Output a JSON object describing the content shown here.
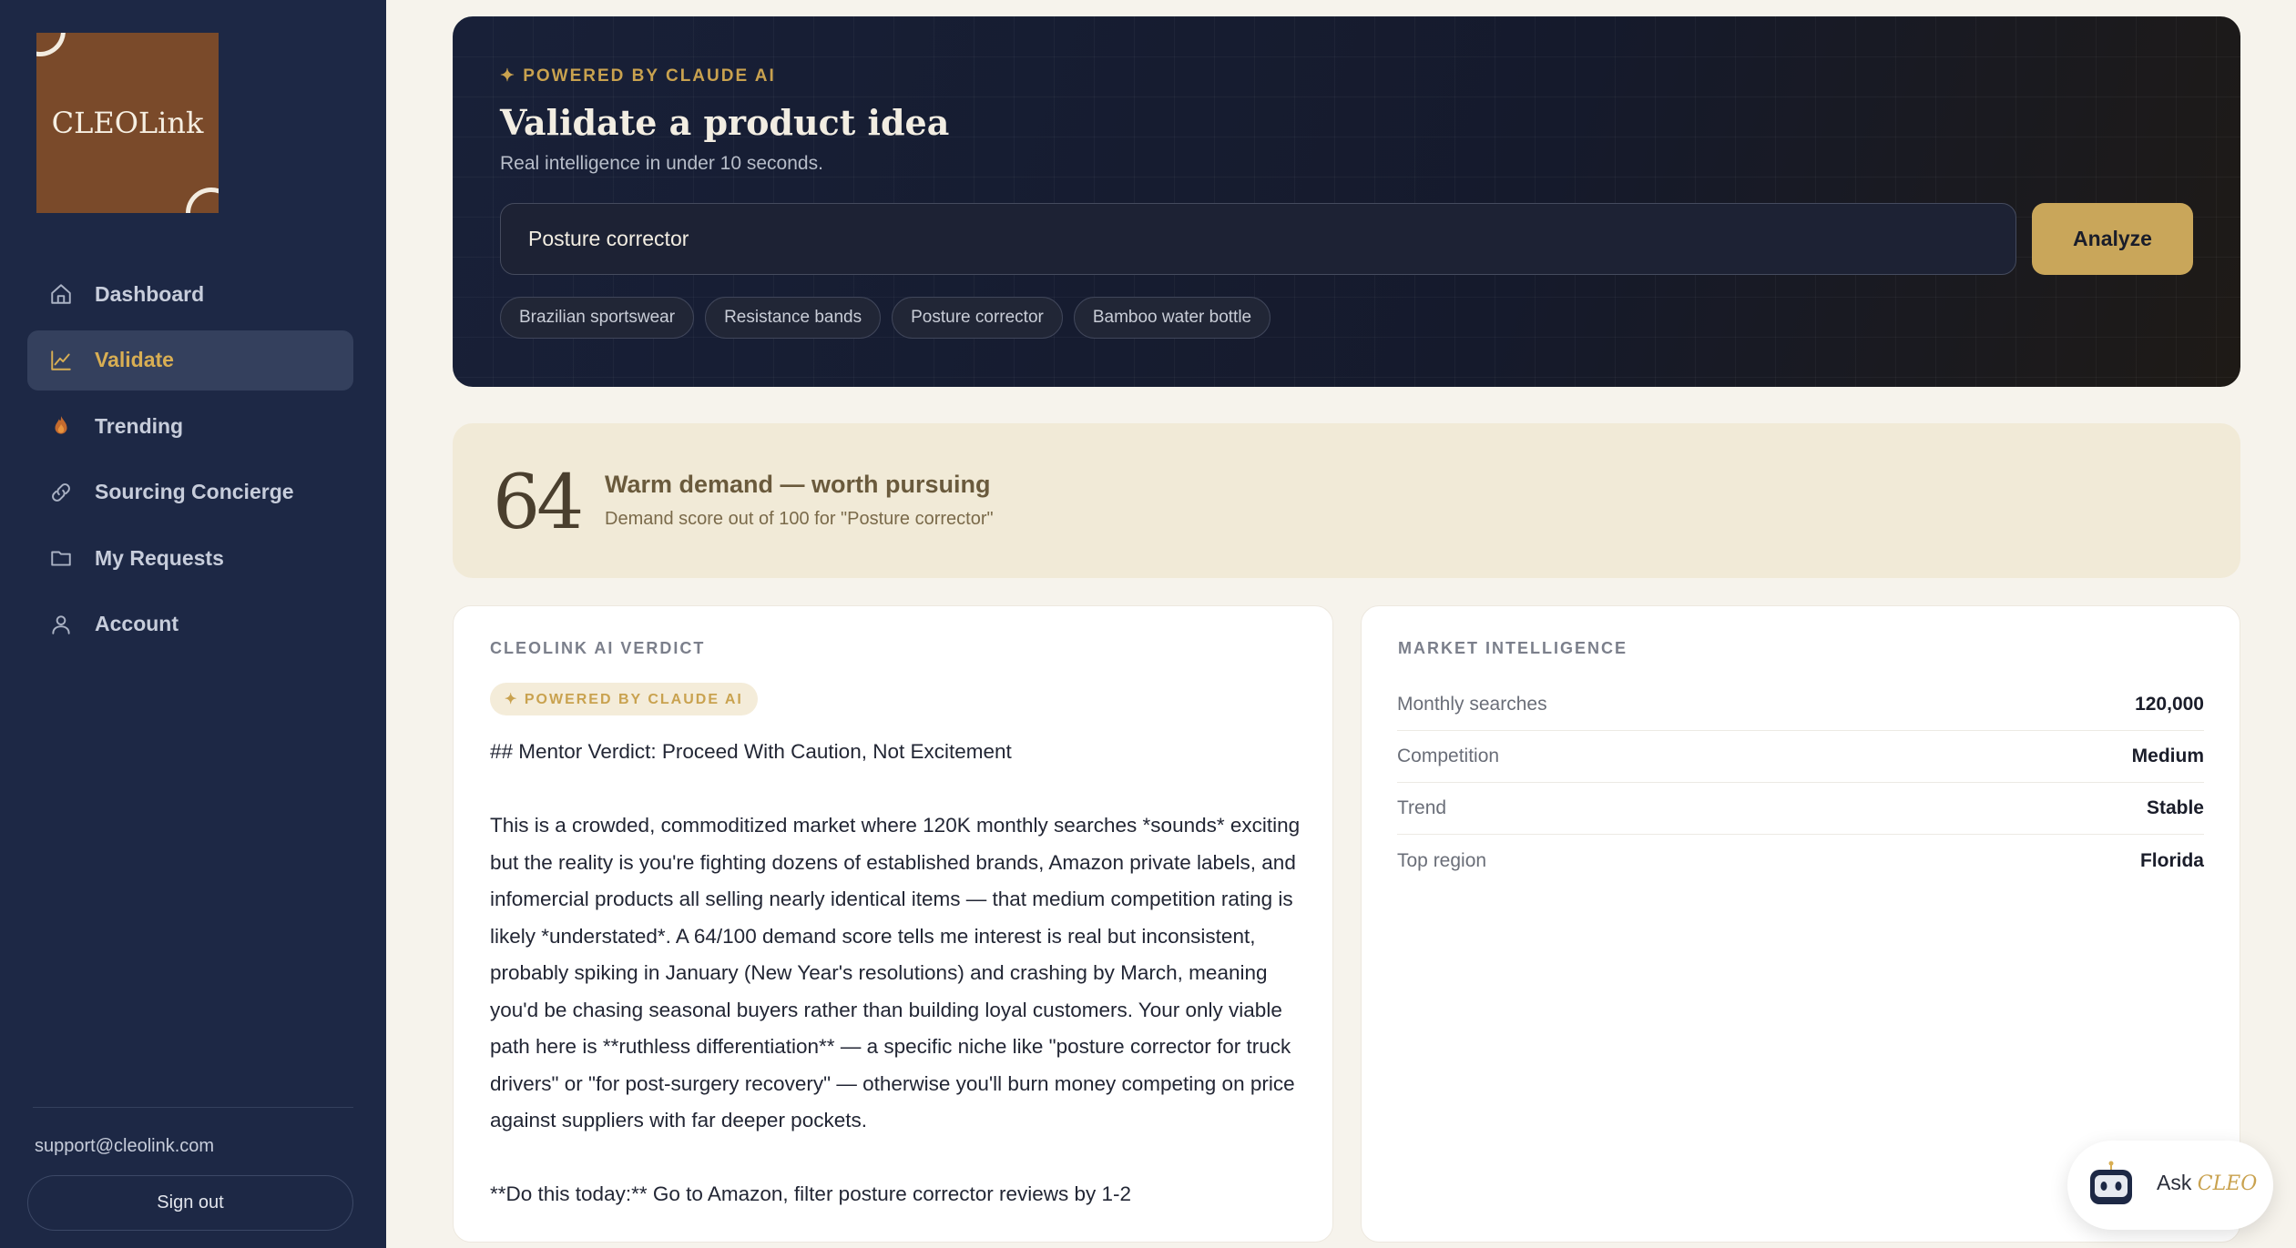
{
  "brand": {
    "logo_text": "CLEOLink"
  },
  "sidebar": {
    "items": [
      {
        "label": "Dashboard",
        "icon": "home-icon",
        "active": false
      },
      {
        "label": "Validate",
        "icon": "chart-line-icon",
        "active": true
      },
      {
        "label": "Trending",
        "icon": "flame-icon",
        "active": false
      },
      {
        "label": "Sourcing Concierge",
        "icon": "link-icon",
        "active": false
      },
      {
        "label": "My Requests",
        "icon": "folder-icon",
        "active": false
      },
      {
        "label": "Account",
        "icon": "user-icon",
        "active": false
      }
    ],
    "support_email": "support@cleolink.com",
    "sign_out": "Sign out"
  },
  "hero": {
    "powered": "✦ POWERED BY CLAUDE AI",
    "title": "Validate a product idea",
    "subtitle": "Real intelligence in under 10 seconds.",
    "search_value": "Posture corrector",
    "analyze_label": "Analyze",
    "suggestions": [
      "Brazilian sportswear",
      "Resistance bands",
      "Posture corrector",
      "Bamboo water bottle"
    ]
  },
  "score": {
    "value": "64",
    "title": "Warm demand — worth pursuing",
    "subtitle": "Demand score out of 100 for \"Posture corrector\""
  },
  "verdict": {
    "label": "CLEOLINK AI VERDICT",
    "badge": "✦ POWERED BY CLAUDE AI",
    "heading": "## Mentor Verdict: Proceed With Caution, Not Excitement",
    "body": "This is a crowded, commoditized market where 120K monthly searches *sounds* exciting but the reality is you're fighting dozens of established brands, Amazon private labels, and infomercial products all selling nearly identical items — that medium competition rating is likely *understated*. A 64/100 demand score tells me interest is real but inconsistent, probably spiking in January (New Year's resolutions) and crashing by March, meaning you'd be chasing seasonal buyers rather than building loyal customers. Your only viable path here is **ruthless differentiation** — a specific niche like \"posture corrector for truck drivers\" or \"for post-surgery recovery\" — otherwise you'll burn money competing on price against suppliers with far deeper pockets.",
    "action": "**Do this today:** Go to Amazon, filter posture corrector reviews by 1-2"
  },
  "market": {
    "label": "MARKET INTELLIGENCE",
    "rows": [
      {
        "label": "Monthly searches",
        "value": "120,000"
      },
      {
        "label": "Competition",
        "value": "Medium"
      },
      {
        "label": "Trend",
        "value": "Stable"
      },
      {
        "label": "Top region",
        "value": "Florida"
      }
    ]
  },
  "assistant": {
    "ask": "Ask",
    "brand": "CLEO",
    "icon": "robot-icon"
  },
  "colors": {
    "sidebar": "#1d2845",
    "accent": "#c9a65a",
    "hero": "#141a2e",
    "score_bg": "#f1ead7"
  }
}
